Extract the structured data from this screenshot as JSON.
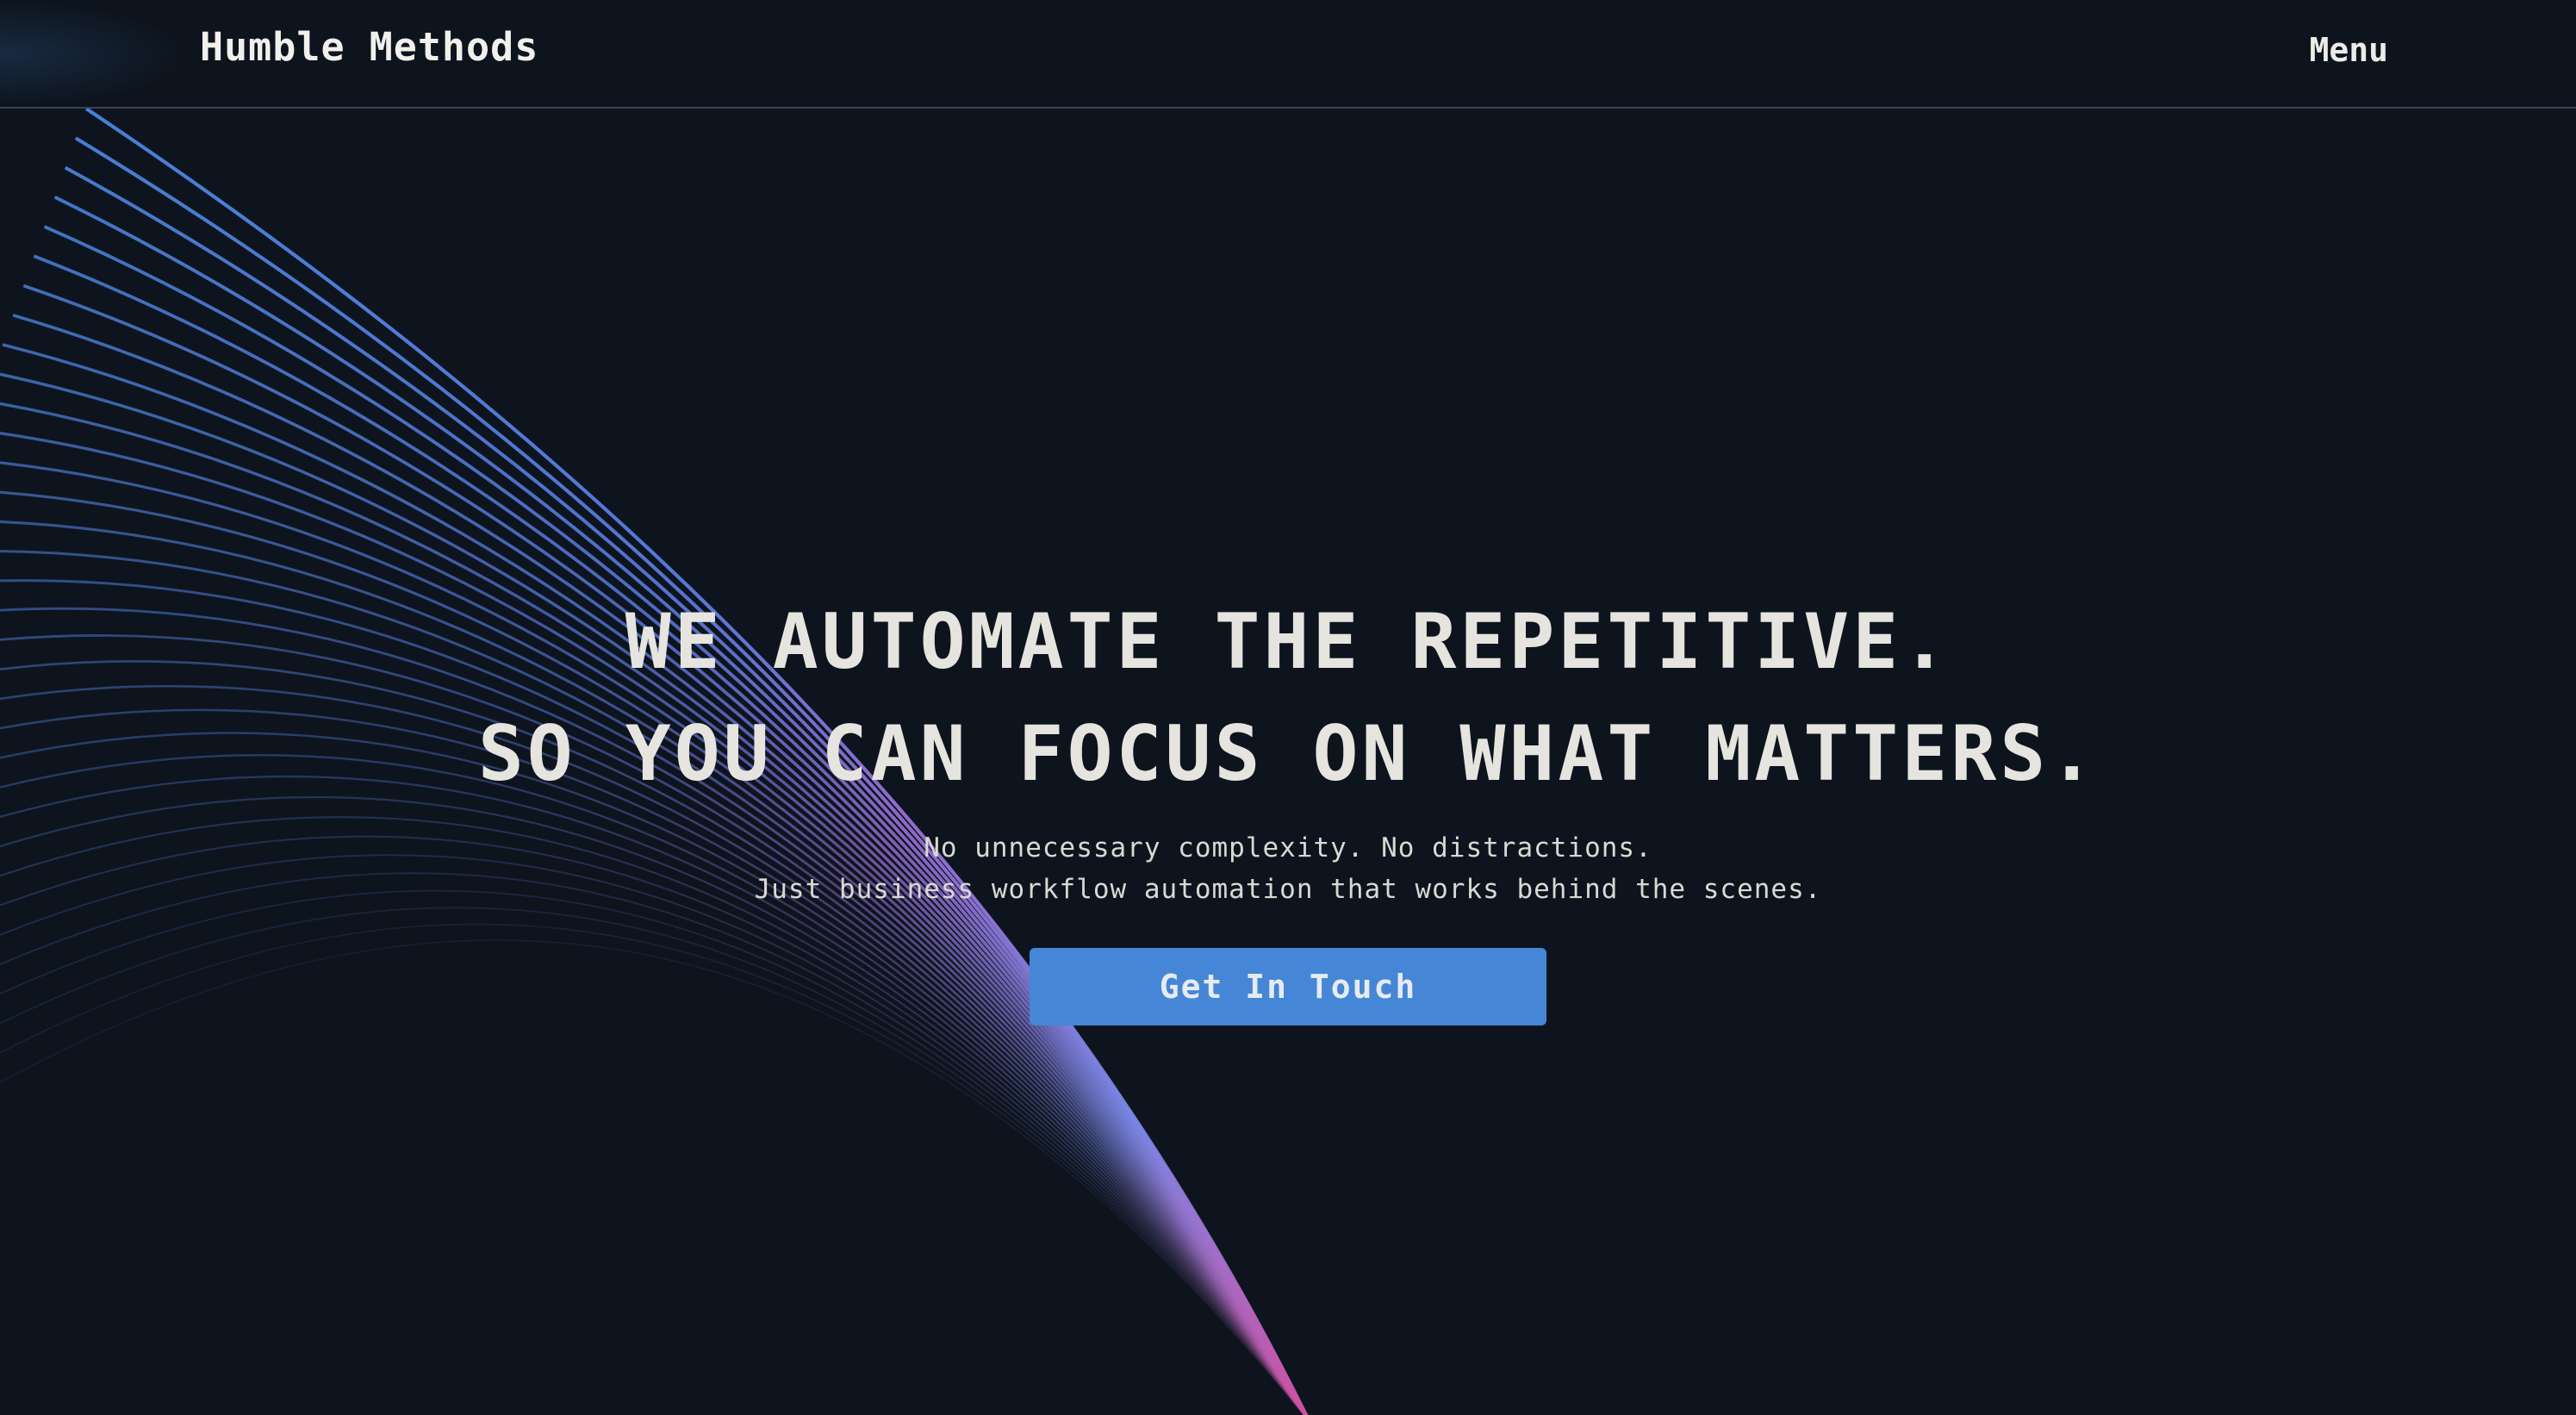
{
  "header": {
    "brand": "Humble Methods",
    "menu_label": "Menu"
  },
  "hero": {
    "headline_line1": "WE AUTOMATE THE REPETITIVE.",
    "headline_line2": "SO YOU CAN FOCUS ON WHAT MATTERS.",
    "subtext_line1": "No unnecessary complexity. No distractions.",
    "subtext_line2": "Just business workflow automation that works behind the scenes.",
    "cta_label": "Get In Touch"
  },
  "colors": {
    "background": "#0d141d",
    "accent": "#4686d6",
    "wave_blue": "#4a86e0",
    "wave_purple": "#9a6fd6",
    "wave_pink": "#d04fa0",
    "text": "#e6e4df"
  }
}
